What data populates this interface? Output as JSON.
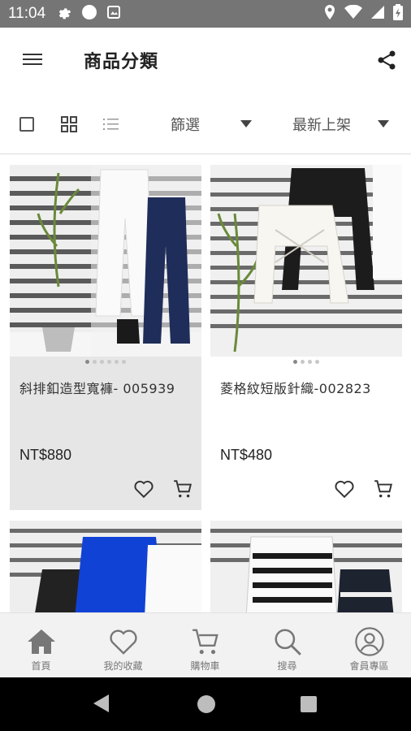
{
  "status_bar": {
    "time": "11:04"
  },
  "header": {
    "title": "商品分類"
  },
  "toolbar": {
    "filter_label": "篩選",
    "sort_label": "最新上架"
  },
  "products": [
    {
      "name": "斜排釦造型寬褲- 005939",
      "price": "NT$880",
      "image_count": 6,
      "active_image": 0
    },
    {
      "name": "菱格紋短版針織-002823",
      "price": "NT$480",
      "image_count": 4,
      "active_image": 0
    },
    {
      "name": "",
      "price": "",
      "image_count": 0,
      "active_image": 0
    },
    {
      "name": "",
      "price": "",
      "image_count": 0,
      "active_image": 0
    }
  ],
  "bottom_nav": {
    "items": [
      {
        "label": "首頁",
        "icon": "home-icon",
        "active": true
      },
      {
        "label": "我的收藏",
        "icon": "heart-icon",
        "active": false
      },
      {
        "label": "購物車",
        "icon": "cart-icon",
        "active": false
      },
      {
        "label": "搜尋",
        "icon": "search-icon",
        "active": false
      },
      {
        "label": "會員專區",
        "icon": "account-icon",
        "active": false
      }
    ]
  },
  "colors": {
    "status_bar": "#757575",
    "card_selected_bg": "#e6e6e6",
    "nav_bg": "#f2f2f2",
    "icon_gray": "#555555"
  }
}
